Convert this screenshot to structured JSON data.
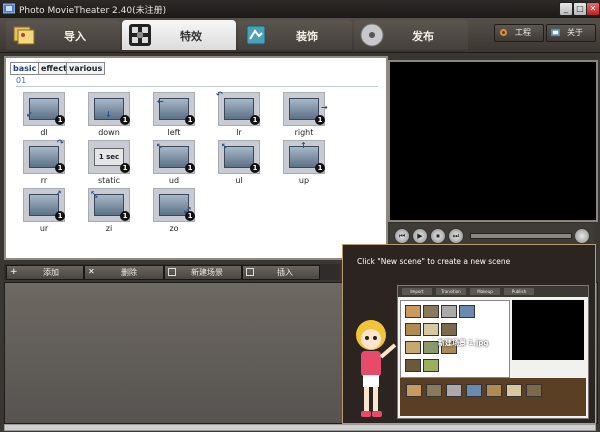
{
  "window": {
    "title": "Photo MovieTheater 2.40(未注册)",
    "controls": [
      "_",
      "□",
      "✕"
    ]
  },
  "nav": {
    "tabs": [
      {
        "label": "导入",
        "icon": "import-icon"
      },
      {
        "label": "特效",
        "icon": "effects-icon",
        "active": true
      },
      {
        "label": "装饰",
        "icon": "decorate-icon"
      },
      {
        "label": "发布",
        "icon": "publish-disc-icon"
      }
    ],
    "project_button": "工程",
    "about_button": "关于"
  },
  "effects_panel": {
    "subtabs": [
      "basic",
      "effect",
      "various"
    ],
    "active_subtab": "basic",
    "group_label": "01",
    "items": [
      {
        "name": "dl",
        "badge": "1",
        "arrow": "↙"
      },
      {
        "name": "down",
        "badge": "1",
        "arrow": "↓"
      },
      {
        "name": "left",
        "badge": "1",
        "arrow": "←"
      },
      {
        "name": "lr",
        "badge": "1",
        "arrow": "↶"
      },
      {
        "name": "right",
        "badge": "1",
        "arrow": "→"
      },
      {
        "name": "rr",
        "badge": "1",
        "arrow": "↷"
      },
      {
        "name": "static",
        "badge": "1",
        "thumb_text": "1 sec"
      },
      {
        "name": "ud",
        "badge": "1",
        "arrow": "↖"
      },
      {
        "name": "ul",
        "badge": "1",
        "arrow": "↖"
      },
      {
        "name": "up",
        "badge": "1",
        "arrow": "↑"
      },
      {
        "name": "ur",
        "badge": "1",
        "arrow": "↗"
      },
      {
        "name": "zi",
        "badge": "1",
        "arrow": "⤡"
      },
      {
        "name": "zo",
        "badge": "1",
        "arrow": "⤢"
      }
    ]
  },
  "player_controls": [
    "⏮",
    "▶",
    "⏹",
    "⏭"
  ],
  "scene_actions": [
    {
      "label": "添加",
      "icon": "add-icon"
    },
    {
      "label": "删除",
      "icon": "delete-icon"
    },
    {
      "label": "新建场景",
      "icon": "new-scene-icon"
    },
    {
      "label": "插入",
      "icon": "insert-icon"
    }
  ],
  "tutorial": {
    "tip": "Click \"New scene\" to create a new scene",
    "mini_tabs": [
      "Import",
      "Transition",
      "Makeup",
      "Publish"
    ],
    "mini_label": "新建场景 1.jpg"
  },
  "colors": {
    "frame_dark": "#2d2a27",
    "active_tab": "#f7f7f7",
    "group_label": "#4a6fa5",
    "badge": "#111111"
  }
}
